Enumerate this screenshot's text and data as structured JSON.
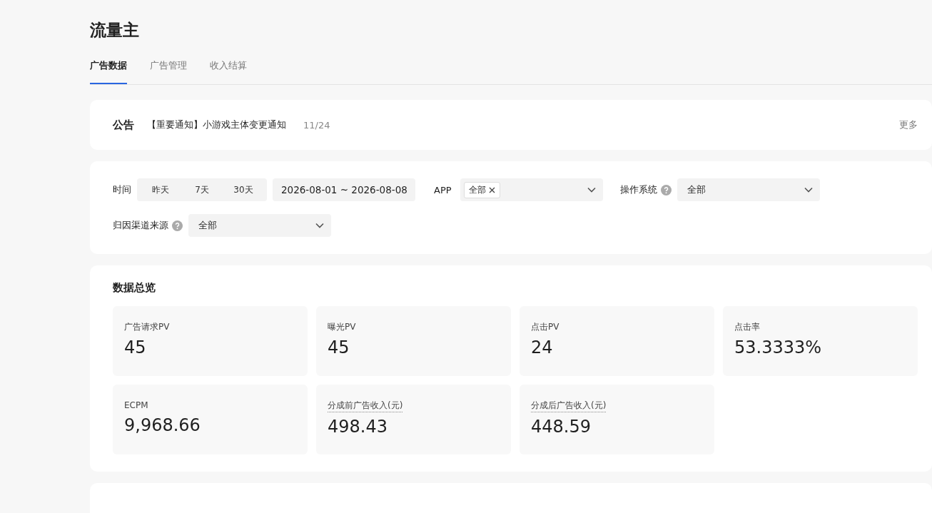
{
  "page_title": "流量主",
  "tabs": [
    {
      "label": "广告数据",
      "selected": true
    },
    {
      "label": "广告管理",
      "selected": false
    },
    {
      "label": "收入结算",
      "selected": false
    }
  ],
  "notice": {
    "label": "公告",
    "text": "【重要通知】小游戏主体变更通知",
    "date": "11/24",
    "more": "更多"
  },
  "filters": {
    "time": {
      "label": "时间",
      "options": [
        {
          "label": "昨天",
          "selected": false
        },
        {
          "label": "7天",
          "selected": false
        },
        {
          "label": "30天",
          "selected": false
        }
      ],
      "range": "2026-08-01 ~ 2026-08-08"
    },
    "app": {
      "label": "APP",
      "tags": [
        "全部"
      ]
    },
    "os": {
      "label": "操作系统",
      "help": true,
      "value": "全部"
    },
    "channel": {
      "label": "归因渠道来源",
      "help": true,
      "value": "全部"
    }
  },
  "overview": {
    "title": "数据总览",
    "metrics": [
      {
        "label": "广告请求PV",
        "value": "45",
        "tip": false
      },
      {
        "label": "曝光PV",
        "value": "45",
        "tip": false
      },
      {
        "label": "点击PV",
        "value": "24",
        "tip": false
      },
      {
        "label": "点击率",
        "value": "53.3333%",
        "tip": false
      },
      {
        "label": "ECPM",
        "value": "9,968.66",
        "tip": false
      },
      {
        "label": "分成前广告收入(元)",
        "value": "498.43",
        "tip": true
      },
      {
        "label": "分成后广告收入(元)",
        "value": "448.59",
        "tip": true
      }
    ]
  }
}
